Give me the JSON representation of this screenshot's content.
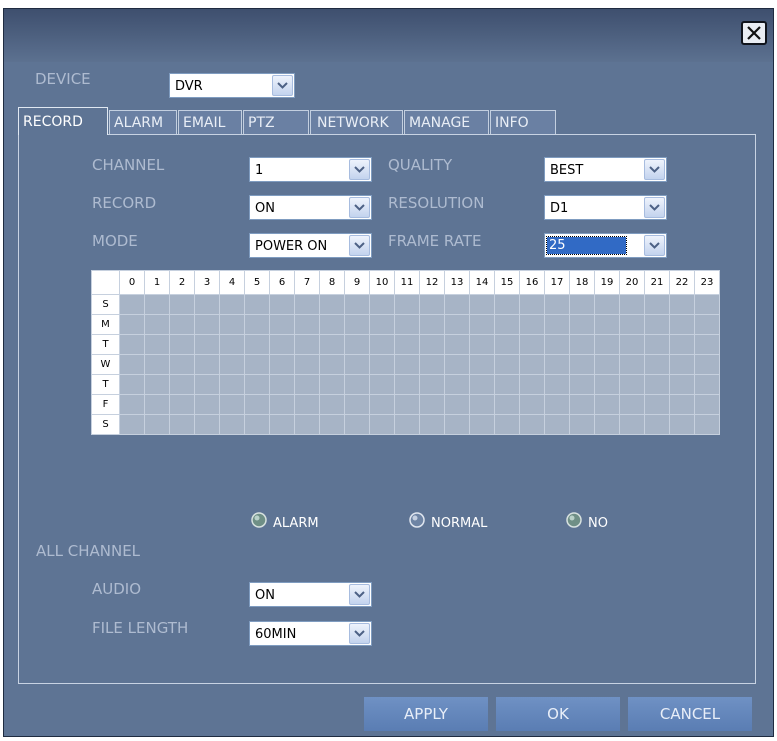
{
  "device": {
    "label": "DEVICE",
    "value": "DVR"
  },
  "tabs": [
    {
      "label": "RECORD",
      "active": true
    },
    {
      "label": "ALARM"
    },
    {
      "label": "EMAIL"
    },
    {
      "label": "PTZ"
    },
    {
      "label": "NETWORK"
    },
    {
      "label": "MANAGE"
    },
    {
      "label": "INFO"
    }
  ],
  "record": {
    "channel": {
      "label": "CHANNEL",
      "value": "1"
    },
    "record": {
      "label": "RECORD",
      "value": "ON"
    },
    "mode": {
      "label": "MODE",
      "value": "POWER ON"
    },
    "quality": {
      "label": "QUALITY",
      "value": "BEST"
    },
    "resolution": {
      "label": "RESOLUTION",
      "value": "D1"
    },
    "frame_rate": {
      "label": "FRAME RATE",
      "value": "25"
    }
  },
  "schedule": {
    "hours": [
      "0",
      "1",
      "2",
      "3",
      "4",
      "5",
      "6",
      "7",
      "8",
      "9",
      "10",
      "11",
      "12",
      "13",
      "14",
      "15",
      "16",
      "17",
      "18",
      "19",
      "20",
      "21",
      "22",
      "23"
    ],
    "days": [
      "S",
      "M",
      "T",
      "W",
      "T",
      "F",
      "S"
    ]
  },
  "legend": {
    "alarm": "ALARM",
    "normal": "NORMAL",
    "no": "NO"
  },
  "all_channel": {
    "label": "ALL CHANNEL",
    "audio": {
      "label": "AUDIO",
      "value": "ON"
    },
    "file_length": {
      "label": "FILE LENGTH",
      "value": "60MIN"
    }
  },
  "buttons": {
    "apply": "APPLY",
    "ok": "OK",
    "cancel": "CANCEL"
  },
  "colors": {
    "window_bg": "#5e7494",
    "grid_cell": "#a7b4c6",
    "button": "#6486bb",
    "label_text": "#aebbd0"
  }
}
